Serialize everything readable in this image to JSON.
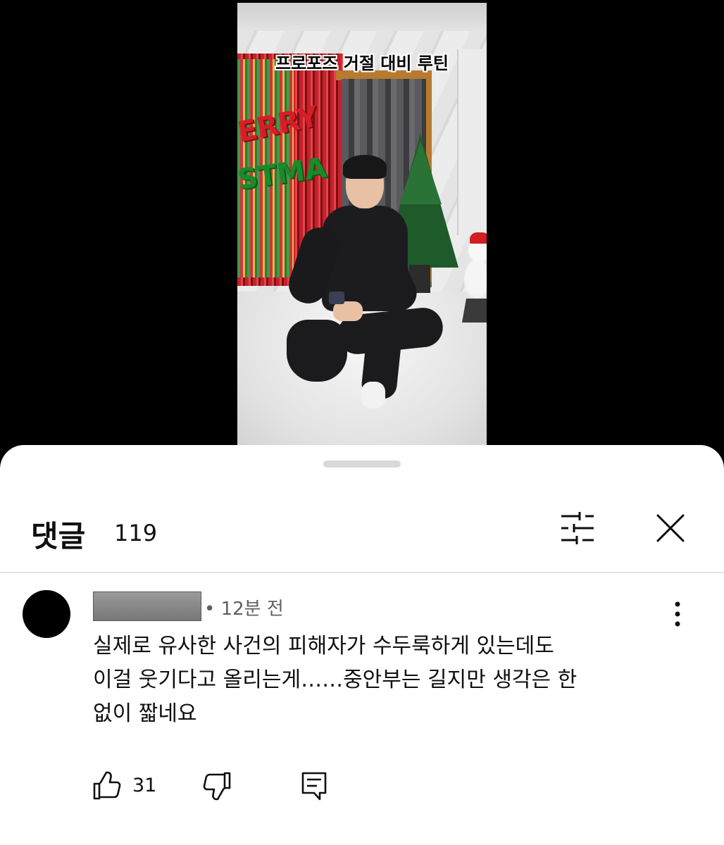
{
  "video": {
    "caption": "프로포즈 거절 대비 루틴",
    "decor_letters": [
      "ERRY",
      "STMA"
    ]
  },
  "comments_sheet": {
    "title": "댓글",
    "count": "119",
    "icons": {
      "filter": "sliders-icon",
      "close": "close-icon"
    }
  },
  "comment": {
    "time": "• 12분 전",
    "text_lines": [
      "실제로 유사한 사건의 피해자가 수두룩하게 있는데도",
      "이걸 웃기다고 올리는게……중안부는 길지만 생각은 한",
      "없이 짧네요"
    ],
    "likes": "31",
    "icons": {
      "more": "more-vert-icon",
      "like": "thumbs-up-icon",
      "dislike": "thumbs-down-icon",
      "reply": "comment-icon"
    }
  },
  "colors": {
    "text_primary": "#0f0f0f",
    "text_secondary": "#606060",
    "sheet_bg": "#ffffff",
    "backdrop": "#000000"
  }
}
